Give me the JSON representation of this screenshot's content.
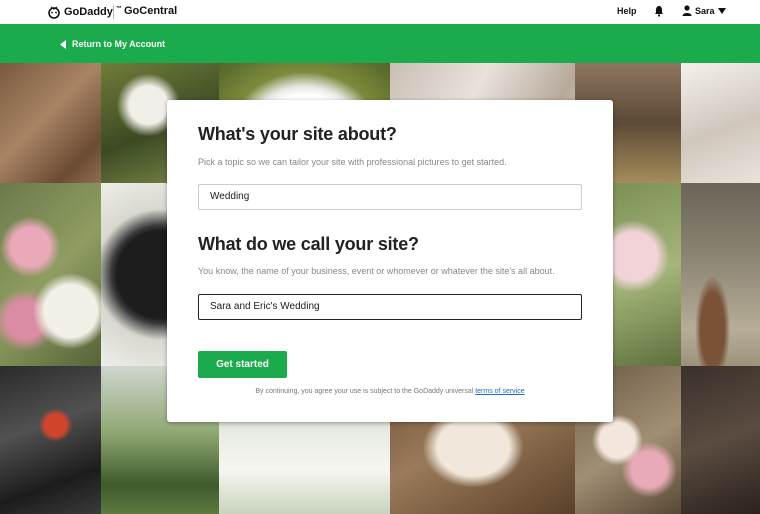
{
  "header": {
    "brand": "GoDaddy",
    "brand_mark": "™",
    "product": "GoCentral",
    "help": "Help",
    "user": "Sara"
  },
  "nav": {
    "back_label": "Return to My Account"
  },
  "form": {
    "topic_heading": "What's your site about?",
    "topic_sub": "Pick a topic so we can tailor your site with professional pictures to get started.",
    "topic_value": "Wedding",
    "name_heading": "What do we call your site?",
    "name_sub": "You know, the name of your business, event or whomever or whatever the site's all about.",
    "name_value": "Sara and Eric's Wedding",
    "submit": "Get started",
    "terms_prefix": "By continuing, you agree your use is subject to the GoDaddy universal",
    "terms_link": "terms of service"
  },
  "colors": {
    "brand_green": "#1bab4c",
    "link_blue": "#1a6ec8"
  }
}
